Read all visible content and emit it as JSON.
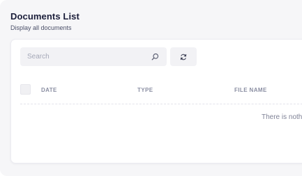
{
  "header": {
    "title": "Documents List",
    "subtitle": "Display all documents"
  },
  "toolbar": {
    "search_placeholder": "Search",
    "search_icon": "search-icon",
    "refresh_icon": "refresh-icon"
  },
  "table": {
    "columns": [
      "DATE",
      "TYPE",
      "FILE NAME"
    ],
    "empty_message": "There is noth"
  },
  "colors": {
    "title": "#1b1e3a",
    "page_background": "#f6f6f8",
    "card_background": "#ffffff",
    "control_background": "#f2f2f5",
    "header_text": "#8a8ea2"
  }
}
